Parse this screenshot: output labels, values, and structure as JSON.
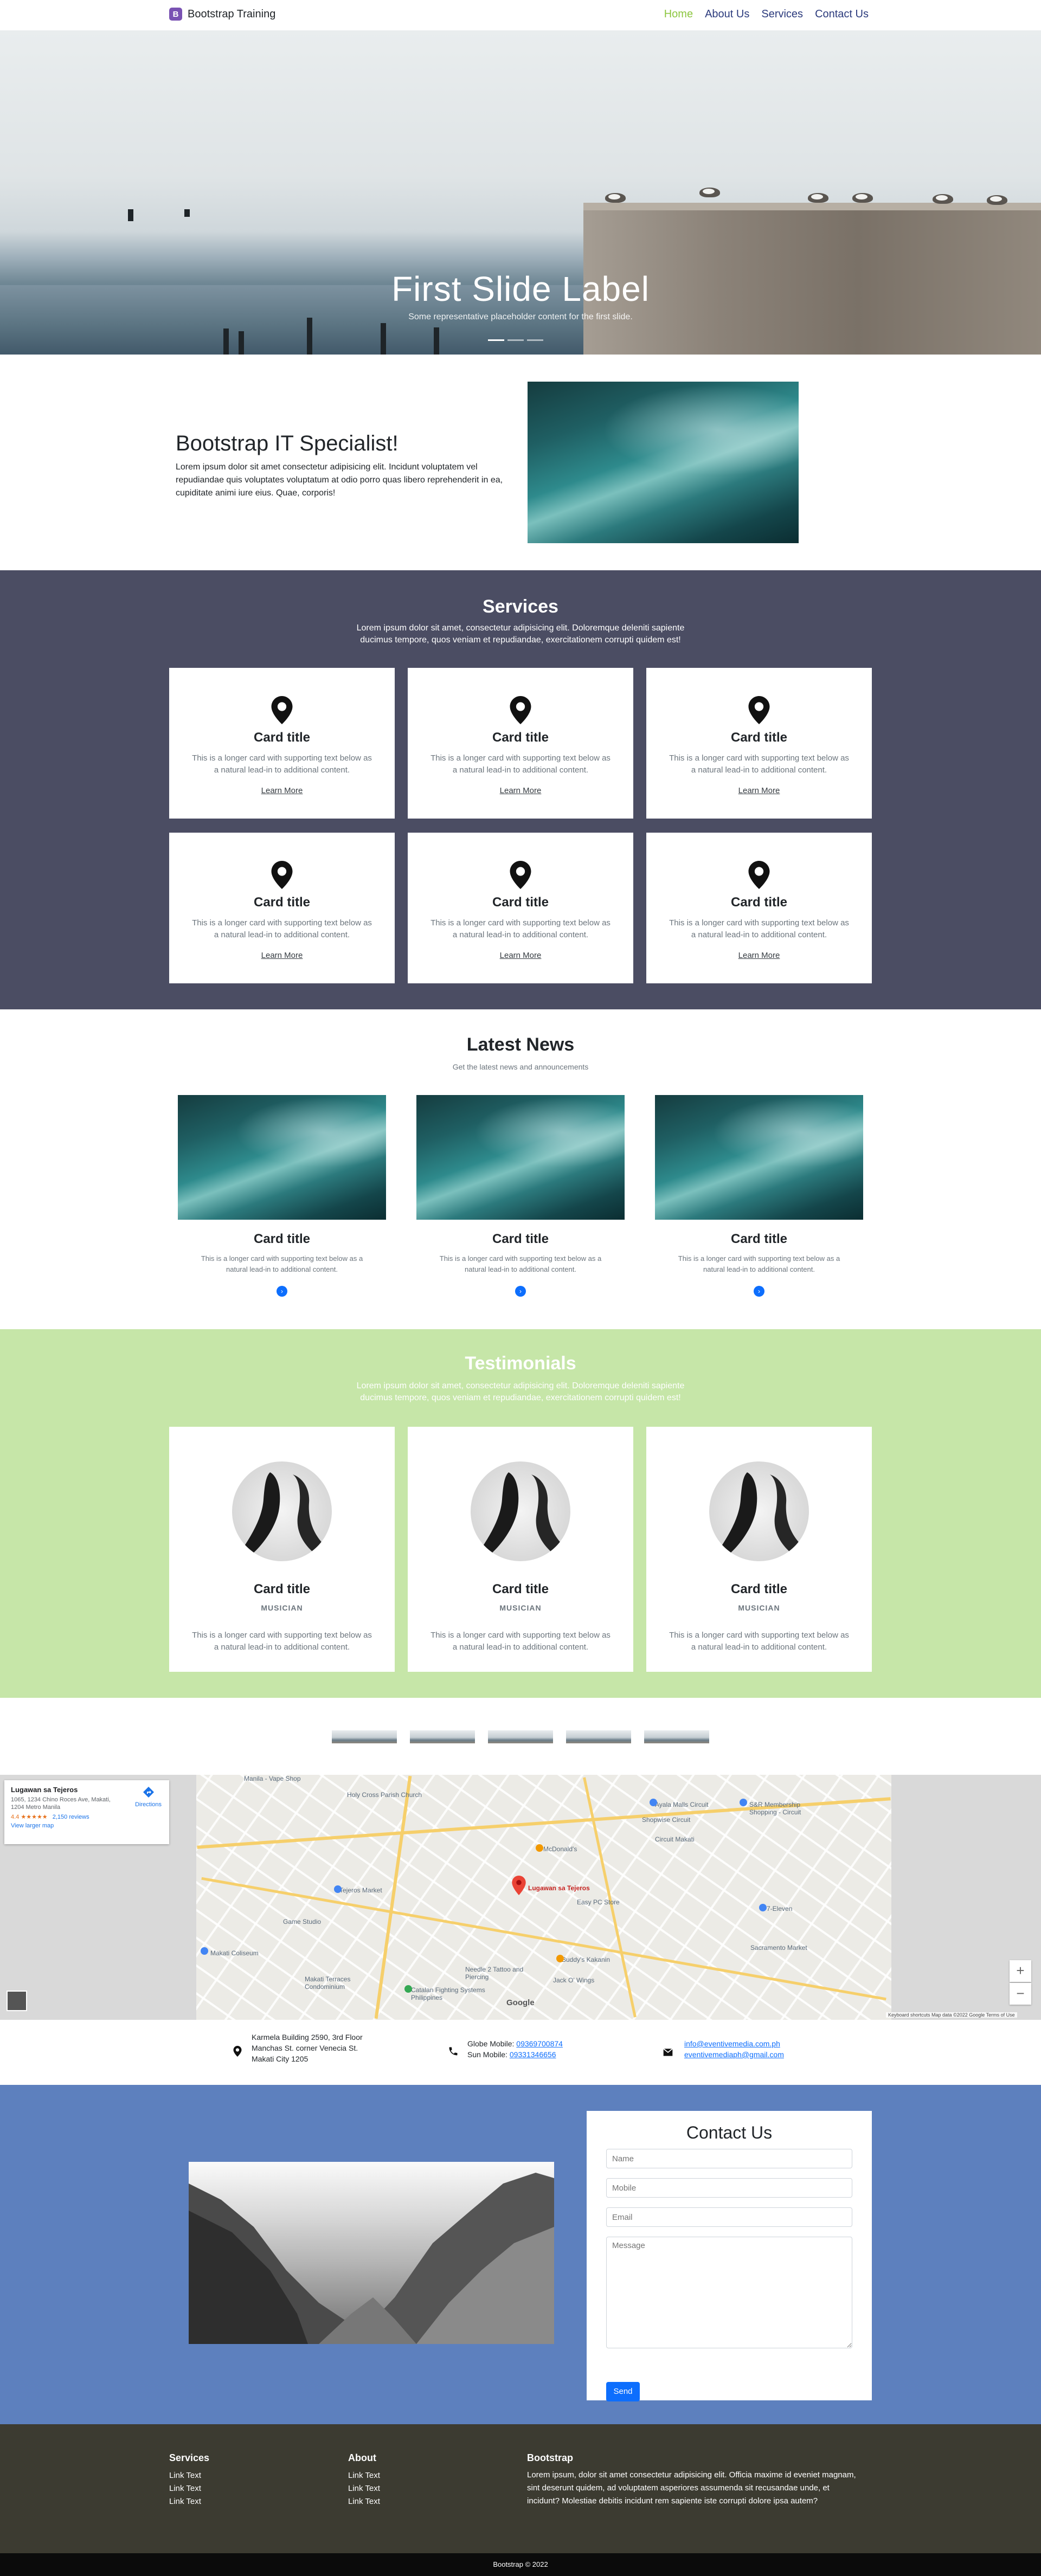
{
  "navbar": {
    "brand_logo": "B",
    "brand": "Bootstrap Training",
    "links": [
      "Home",
      "About Us",
      "Services",
      "Contact Us"
    ]
  },
  "hero": {
    "title": "First Slide Label",
    "subtitle": "Some representative placeholder content for the first slide.",
    "active_slide": 1,
    "slide_count": 3
  },
  "intro": {
    "title": "Bootstrap IT Specialist!",
    "text": "Lorem ipsum dolor sit amet consectetur adipisicing elit. Incidunt voluptatem vel repudiandae quis voluptates voluptatum at odio porro quas libero reprehenderit in ea, cupiditate animi iure eius. Quae, corporis!"
  },
  "services": {
    "title": "Services",
    "lead": "Lorem ipsum dolor sit amet, consectetur adipisicing elit. Doloremque deleniti sapiente ducimus tempore, quos veniam et repudiandae, exercitationem corrupti quidem est!",
    "cards": [
      {
        "title": "Card title",
        "text": "This is a longer card with supporting text below as a natural lead-in to additional content.",
        "link": "Learn More"
      },
      {
        "title": "Card title",
        "text": "This is a longer card with supporting text below as a natural lead-in to additional content.",
        "link": "Learn More"
      },
      {
        "title": "Card title",
        "text": "This is a longer card with supporting text below as a natural lead-in to additional content.",
        "link": "Learn More"
      },
      {
        "title": "Card title",
        "text": "This is a longer card with supporting text below as a natural lead-in to additional content.",
        "link": "Learn More"
      },
      {
        "title": "Card title",
        "text": "This is a longer card with supporting text below as a natural lead-in to additional content.",
        "link": "Learn More"
      },
      {
        "title": "Card title",
        "text": "This is a longer card with supporting text below as a natural lead-in to additional content.",
        "link": "Learn More"
      }
    ]
  },
  "news": {
    "title": "Latest News",
    "subtitle": "Get the latest news and announcements",
    "cards": [
      {
        "title": "Card title",
        "text": "This is a longer card with supporting text below as a natural lead-in to additional content."
      },
      {
        "title": "Card title",
        "text": "This is a longer card with supporting text below as a natural lead-in to additional content."
      },
      {
        "title": "Card title",
        "text": "This is a longer card with supporting text below as a natural lead-in to additional content."
      }
    ]
  },
  "testimonials": {
    "title": "Testimonials",
    "lead": "Lorem ipsum dolor sit amet, consectetur adipisicing elit. Doloremque deleniti sapiente ducimus tempore, quos veniam et repudiandae, exercitationem corrupti quidem est!",
    "cards": [
      {
        "title": "Card title",
        "role": "MUSICIAN",
        "text": "This is a longer card with supporting text below as a natural lead-in to additional content."
      },
      {
        "title": "Card title",
        "role": "MUSICIAN",
        "text": "This is a longer card with supporting text below as a natural lead-in to additional content."
      },
      {
        "title": "Card title",
        "role": "MUSICIAN",
        "text": "This is a longer card with supporting text below as a natural lead-in to additional content."
      }
    ]
  },
  "map": {
    "place_name": "Lugawan sa Tejeros",
    "place_address": "1065, 1234 Chino Roces Ave, Makati, 1204 Metro Manila",
    "rating": "4.4",
    "stars": "★★★★★",
    "reviews": "2,150 reviews",
    "larger_map": "View larger map",
    "directions": "Directions",
    "pin_label": "Lugawan sa Tejeros",
    "footer": "Keyboard shortcuts   Map data ©2022 Google   Terms of Use",
    "labels": [
      "Manila - Vape Shop",
      "Ayala Malls Circuit",
      "S&R Membership Shopping - Circuit",
      "Holy Cross Parish Church",
      "Shopwise Circuit",
      "Circuit Makati",
      "McDonald's",
      "Lugawan sa Tejeros",
      "Easy PC Store",
      "Tejeros Market",
      "Makati Coliseum",
      "Game Studio",
      "Buddy's Kakanin",
      "Catalan Fighting Systems Philippines",
      "Makati Terraces Condominium",
      "Sacramento Market",
      "7-Eleven",
      "Jack O' Wings",
      "Needle 2 Tattoo and Piercing"
    ],
    "zoom_in": "+",
    "zoom_out": "−",
    "google": "Google"
  },
  "contact_info": {
    "address": [
      "Karmela Building 2590, 3rd Floor",
      "Manchas St. corner Venecia St.",
      "Makati City 1205"
    ],
    "globe_label": "Globe Mobile:",
    "globe_number": "09369700874",
    "sun_label": "Sun Mobile:",
    "sun_number": "09331346656",
    "email1": "info@eventivemedia.com.ph",
    "email2": "eventivemediaph@gmail.com"
  },
  "contact": {
    "title": "Contact Us",
    "name_placeholder": "Name",
    "mobile_placeholder": "Mobile",
    "email_placeholder": "Email",
    "message_placeholder": "Message",
    "send": "Send"
  },
  "footer": {
    "services_title": "Services",
    "services_links": [
      "Link Text",
      "Link Text",
      "Link Text"
    ],
    "about_title": "About",
    "about_links": [
      "Link Text",
      "Link Text",
      "Link Text"
    ],
    "bootstrap_title": "Bootstrap",
    "bootstrap_text": "Lorem ipsum, dolor sit amet consectetur adipisicing elit. Officia maxime id eveniet magnam, sint deserunt quidem, ad voluptatem asperiores assumenda sit recusandae unde, et incidunt? Molestiae debitis incidunt rem sapiente iste corrupti dolore ipsa autem?",
    "copyright": "Bootstrap © 2022"
  },
  "colors": {
    "nav_active": "#8cc63f",
    "nav_link": "#2b3a7c",
    "services_bg": "#4b4d63",
    "testimonials_bg": "#c6e6a8",
    "contact_bg": "#5d80be",
    "footer_bg": "#3c3b31",
    "primary": "#0d6efd"
  }
}
